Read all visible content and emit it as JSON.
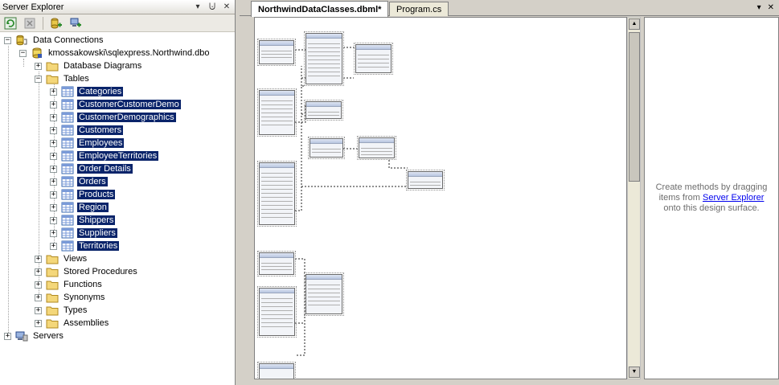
{
  "server_explorer": {
    "title": "Server Explorer",
    "pin_glyph": "⨃",
    "close_glyph": "✕",
    "dropdown_glyph": "▾",
    "toolbar": [
      "refresh-icon",
      "stop-icon",
      "connect-to-database-icon",
      "connect-to-server-icon"
    ],
    "tree": {
      "data_connections": "Data Connections",
      "connection": "kmossakowski\\sqlexpress.Northwind.dbo",
      "database_diagrams": "Database Diagrams",
      "tables": "Tables",
      "table_items": [
        "Categories",
        "CustomerCustomerDemo",
        "CustomerDemographics",
        "Customers",
        "Employees",
        "EmployeeTerritories",
        "Order Details",
        "Orders",
        "Products",
        "Region",
        "Shippers",
        "Suppliers",
        "Territories"
      ],
      "views": "Views",
      "stored_procedures": "Stored Procedures",
      "functions": "Functions",
      "synonyms": "Synonyms",
      "types": "Types",
      "assemblies": "Assemblies",
      "servers": "Servers"
    }
  },
  "document": {
    "tabs": [
      {
        "label": "NorthwindDataClasses.dbml*",
        "active": true
      },
      {
        "label": "Program.cs",
        "active": false
      }
    ],
    "window_controls": {
      "dropdown": "▾",
      "close": "✕"
    },
    "methods_pane": {
      "text_before": "Create methods by dragging items from",
      "link": "Server Explorer",
      "text_after": "onto this design surface."
    }
  },
  "colors": {
    "selection": "#0a246a",
    "link": "#0000ee"
  }
}
